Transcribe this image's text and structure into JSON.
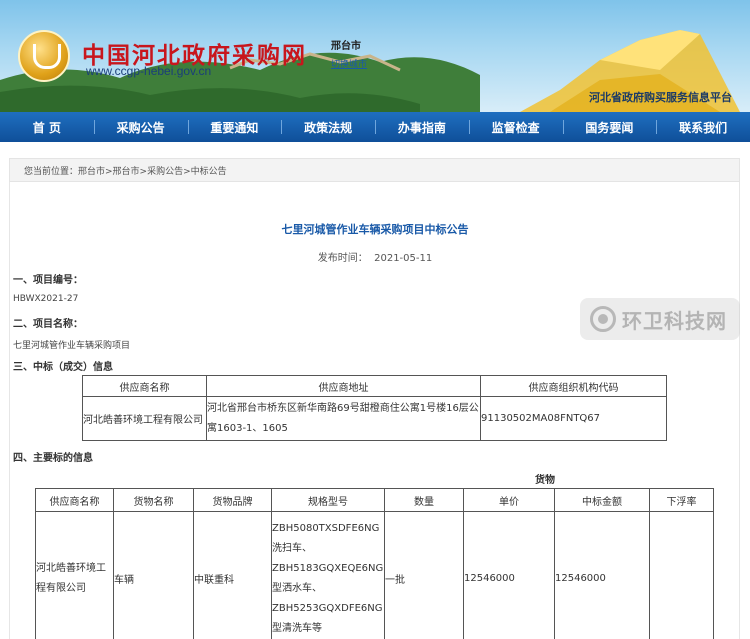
{
  "header": {
    "logo_text": "中国河北政府采购网",
    "logo_url": "www.ccgp-hebei.gov.cn",
    "city": "邢台市",
    "city_switch": "切换城市",
    "platform": "河北省政府购买服务信息平台"
  },
  "nav": [
    "首 页",
    "采购公告",
    "重要通知",
    "政策法规",
    "办事指南",
    "监督检查",
    "国务要闻",
    "联系我们"
  ],
  "breadcrumb": "您当前位置：邢台市>邢台市>采购公告>中标公告",
  "article": {
    "title": "七里河城管作业车辆采购项目中标公告",
    "publish_label": "发布时间：",
    "publish_date": "2021-05-11",
    "s1": "一、项目编号：",
    "project_no": "HBWX2021-27",
    "s2": "二、项目名称：",
    "project_name": "七里河城管作业车辆采购项目",
    "s3": "三、中标（成交）信息",
    "s4": "四、主要标的信息"
  },
  "winner_table": {
    "headers": [
      "供应商名称",
      "供应商地址",
      "供应商组织机构代码"
    ],
    "row": [
      "河北皓善环境工程有限公司",
      "河北省邢台市桥东区新华南路69号甜橙商住公寓1号楼16层公寓1603-1、1605",
      "91130502MA08FNTQ67"
    ]
  },
  "goods_table": {
    "group_label": "货物",
    "headers": [
      "供应商名称",
      "货物名称",
      "货物品牌",
      "规格型号",
      "数量",
      "单价",
      "中标金额",
      "下浮率"
    ],
    "row": {
      "supplier": "河北皓善环境工程有限公司",
      "goods": "车辆",
      "brand": "中联重科",
      "model_1": "ZBH5080TXSDFE6NG",
      "model_2": "洗扫车、",
      "model_3": "ZBH5183GQXEQE6NG",
      "model_4": "型洒水车、",
      "model_5": "ZBH5253GQXDFE6NG",
      "model_6": "型清洗车等",
      "qty": "一批",
      "unit_price": "12546000",
      "amount": "12546000",
      "float_rate": ""
    }
  },
  "watermark": "环卫科技网"
}
